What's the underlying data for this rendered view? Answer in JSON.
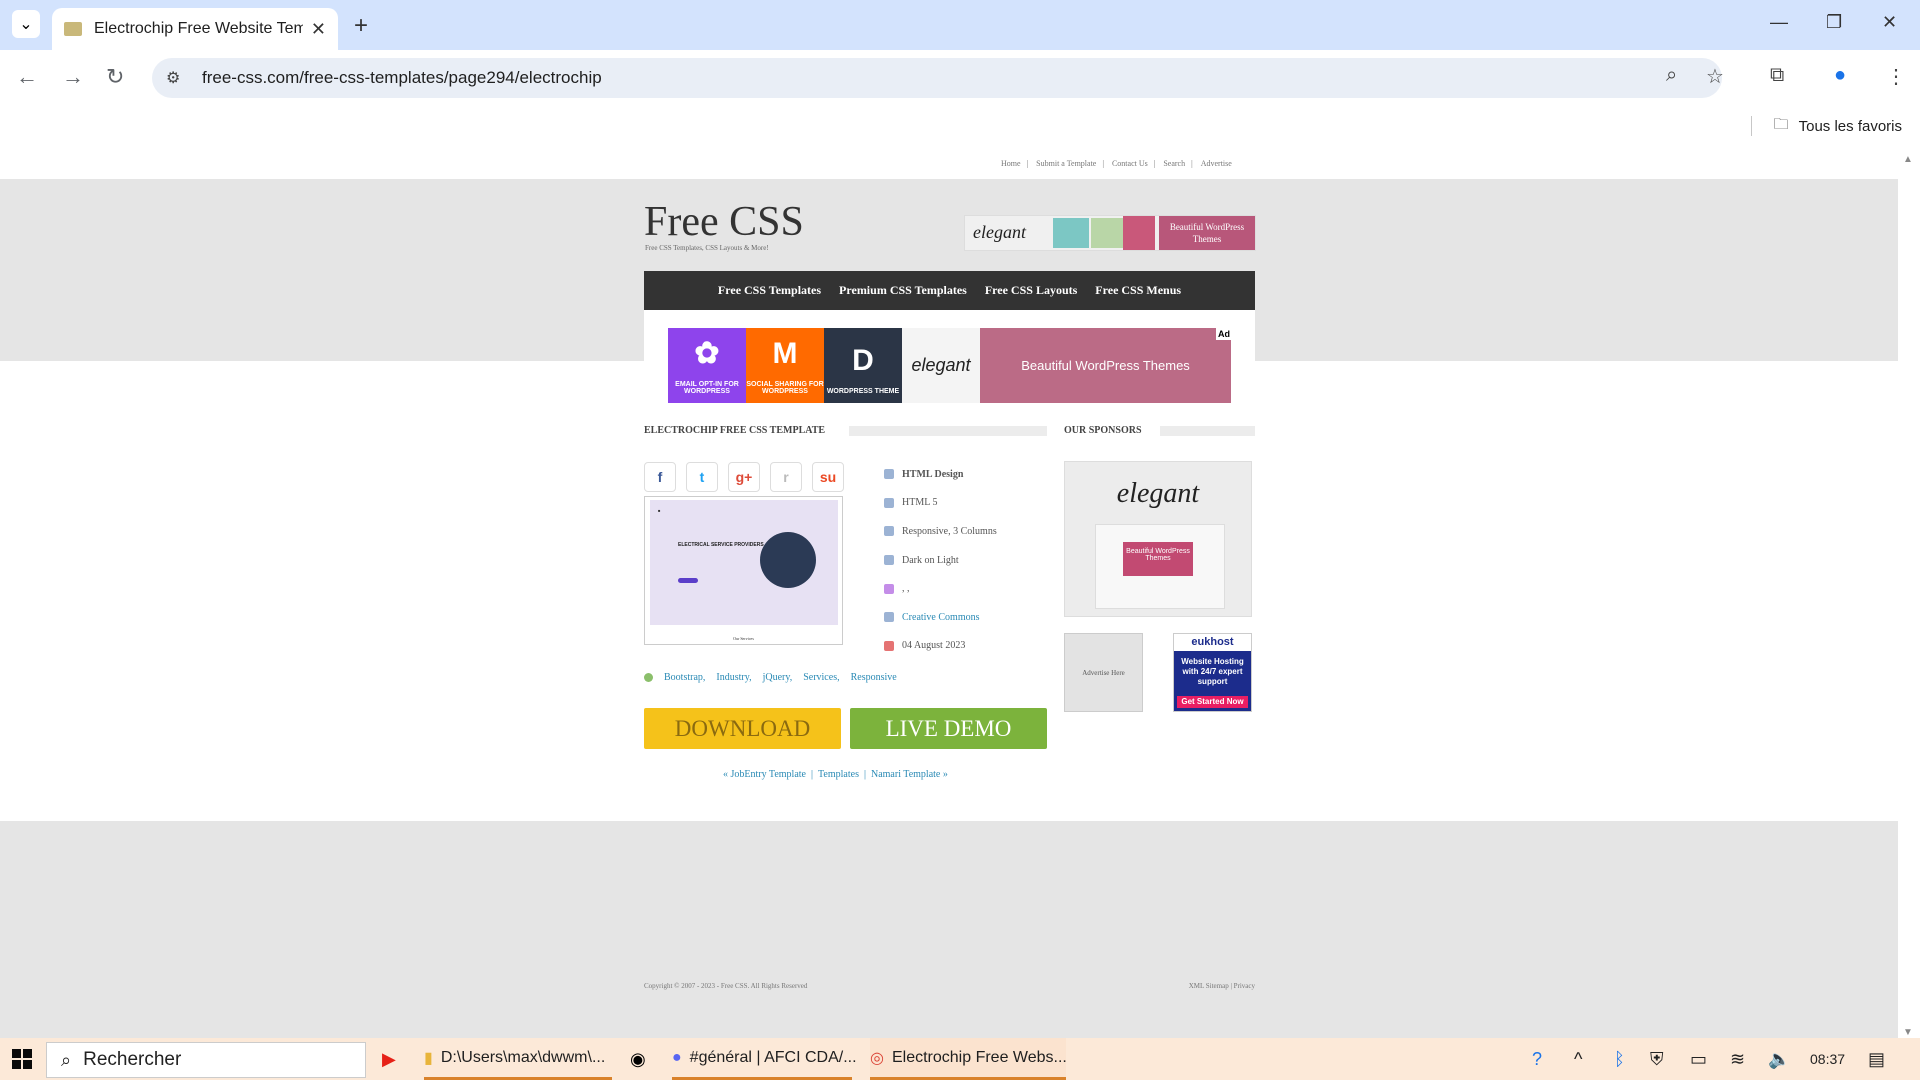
{
  "browser": {
    "tab_title": "Electrochip Free Website Templ",
    "url": "free-css.com/free-css-templates/page294/electrochip",
    "bookmarks_all": "Tous les favoris"
  },
  "site": {
    "top_links": [
      "Home",
      "Submit a Template",
      "Contact Us",
      "Search",
      "Advertise"
    ],
    "logo": "Free CSS",
    "tagline": "Free CSS Templates, CSS Layouts & More!",
    "header_ad": {
      "brand": "elegant",
      "pink": "Beautiful WordPress Themes"
    },
    "main_nav": [
      "Free CSS Templates",
      "Premium CSS Templates",
      "Free CSS Layouts",
      "Free CSS Menus"
    ],
    "big_ad": {
      "box1": "EMAIL OPT-IN FOR WORDPRESS",
      "box2": "SOCIAL SHARING FOR WORDPRESS",
      "box3": "WORDPRESS THEME",
      "box4": "elegant",
      "box5": "Beautiful WordPress Themes",
      "badge": "Ad"
    },
    "section_title": "ELECTROCHIP FREE CSS TEMPLATE",
    "sponsors_title": "OUR SPONSORS",
    "social": [
      "f",
      "t",
      "g+",
      "r",
      "su"
    ],
    "thumb": {
      "text": "ELECTRICAL SERVICE PROVIDERS",
      "footer": "Our Services"
    },
    "specs": [
      {
        "label": "HTML Design"
      },
      {
        "label": "HTML 5"
      },
      {
        "label": "Responsive, 3 Columns"
      },
      {
        "label": "Dark on Light"
      },
      {
        "label": ", ,"
      },
      {
        "label": "Creative Commons"
      },
      {
        "label": "04 August 2023"
      }
    ],
    "tags": [
      "Bootstrap,",
      "Industry,",
      "jQuery,",
      "Services,",
      "Responsive"
    ],
    "download_label": "DOWNLOAD",
    "live_demo_label": "LIVE DEMO",
    "pager": {
      "prev": "« JobEntry Template",
      "middle": "Templates",
      "next": "Namari Template »"
    },
    "sponsor_big": {
      "brand": "elegant",
      "pink": "Beautiful WordPress Themes"
    },
    "sponsor_adv": "Advertise Here",
    "sponsor_euk": {
      "brand": "eukhost",
      "text": "Website Hosting with 24/7 expert support",
      "cta": "Get Started Now"
    },
    "copyright": "Copyright © 2007 - 2023 - Free CSS. All Rights Reserved",
    "footer_links": "XML Sitemap | Privacy"
  },
  "taskbar": {
    "search_placeholder": "Rechercher",
    "apps": [
      {
        "label": "D:\\Users\\max\\dwwm\\..."
      },
      {
        "label": "#général | AFCI CDA/..."
      },
      {
        "label": "Electrochip Free Webs..."
      }
    ],
    "time": "08:37"
  }
}
